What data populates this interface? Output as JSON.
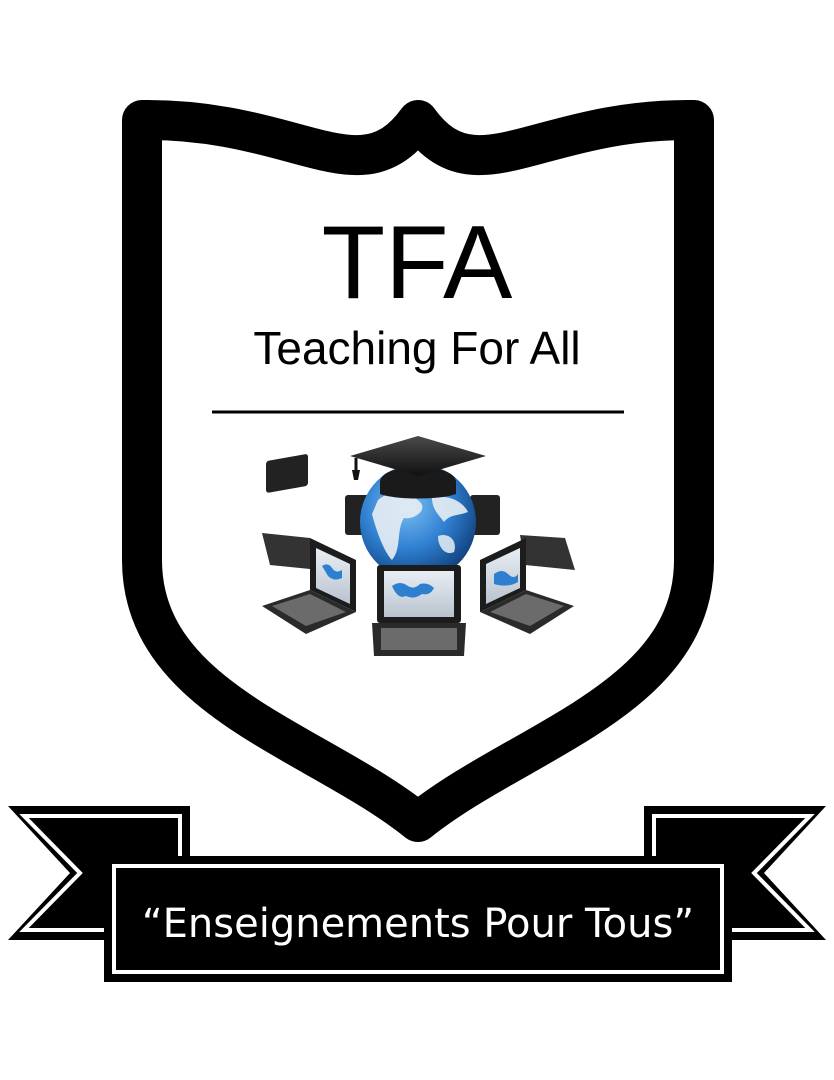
{
  "crest": {
    "title": "TFA",
    "subtitle": "Teaching For All",
    "motto": "“Enseignements Pour Tous”"
  },
  "emblem": {
    "icons": [
      "graduation-cap-icon",
      "globe-icon",
      "laptop-icon"
    ]
  },
  "colors": {
    "ink": "#000000",
    "background": "#ffffff",
    "ocean": "#2f7fd0",
    "land": "#e8eef4"
  }
}
